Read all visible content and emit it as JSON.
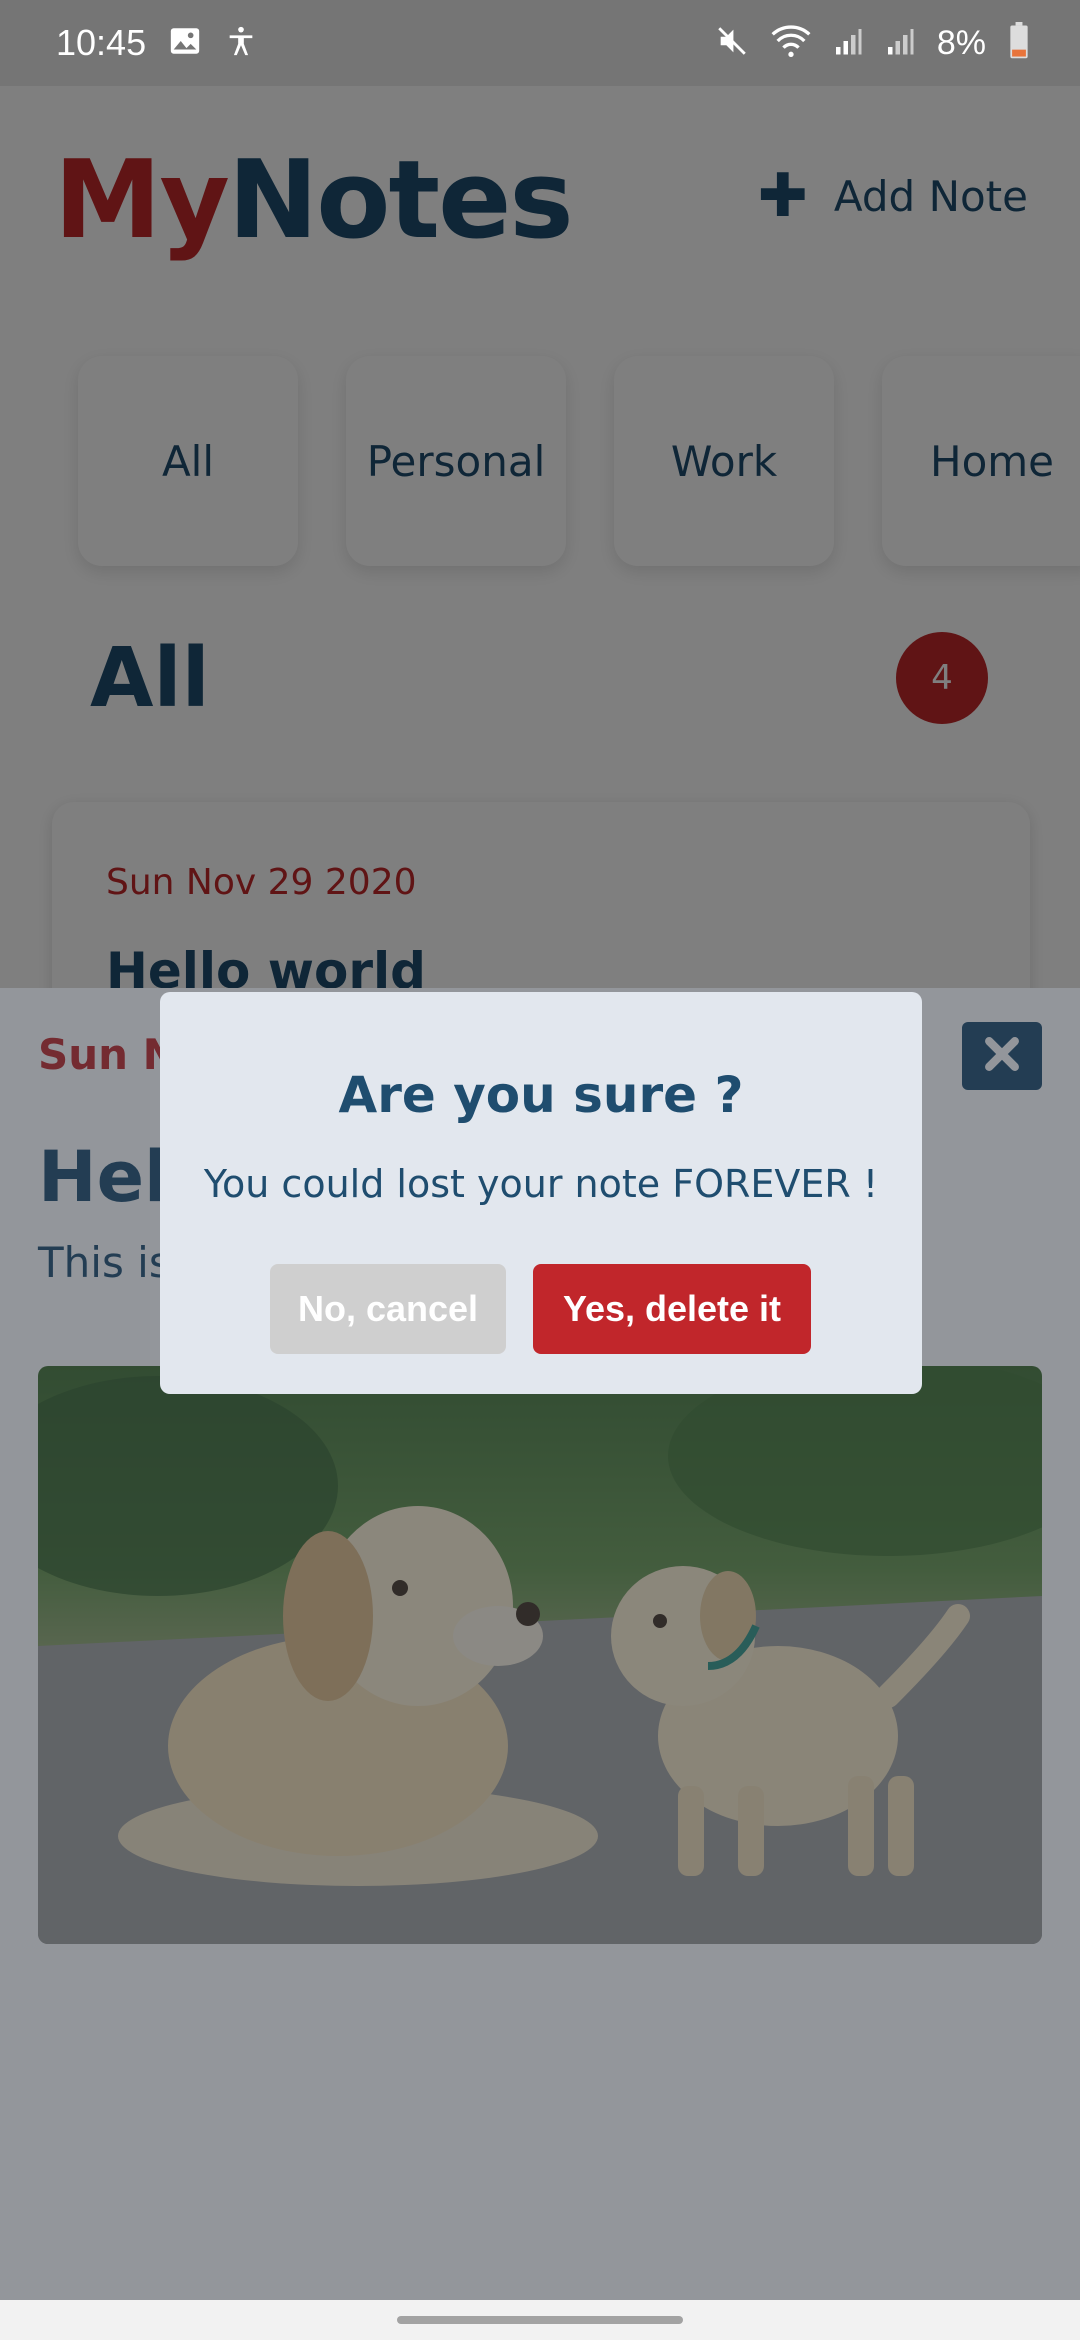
{
  "status_bar": {
    "time": "10:45",
    "battery_percent": "8%",
    "icons": [
      "image-icon",
      "accessibility-icon",
      "mute-icon",
      "wifi-icon",
      "signal-icon",
      "signal-icon",
      "battery-icon"
    ]
  },
  "header": {
    "logo_part1": "My",
    "logo_part2": "Notes",
    "add_note_label": "Add Note"
  },
  "categories": [
    "All",
    "Personal",
    "Work",
    "Home"
  ],
  "section": {
    "title": "All",
    "count": "4"
  },
  "note_card": {
    "date": "Sun Nov 29 2020",
    "title": "Hello world"
  },
  "detail": {
    "date": "Sun N",
    "title": "Hell",
    "text": "This is",
    "image_alt": "Two labrador dogs on a path"
  },
  "dialog": {
    "title": "Are you sure ?",
    "message": "You could lost your note FOREVER !",
    "cancel_label": "No, cancel",
    "confirm_label": "Yes, delete it"
  },
  "colors": {
    "brand_red": "#c0282a",
    "brand_blue": "#1f4d6f",
    "dialog_bg": "#e2e7ee",
    "cancel_bg": "#cfcfcf",
    "delete_bg": "#c1262b"
  }
}
